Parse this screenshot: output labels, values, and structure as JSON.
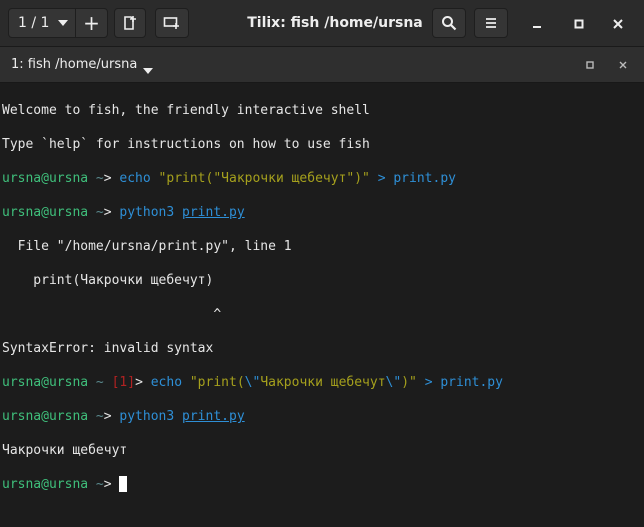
{
  "window": {
    "title": "Tilix: fish /home/ursna"
  },
  "header": {
    "session_label": "1 / 1",
    "add_label": "+"
  },
  "tab": {
    "title": "1: fish /home/ursna"
  },
  "terminal": {
    "welcome": "Welcome to fish, the friendly interactive shell",
    "help": "Type `help` for instructions on how to use fish",
    "prompt_user": "ursna@ursna",
    "prompt_tilde": " ~",
    "prompt_arrow": "> ",
    "cmd1": {
      "name": "echo",
      "arg": "\"print(\"Чакрочки щебечут\")\"",
      "redirect": ">",
      "target": "print.py"
    },
    "cmd2": {
      "name": "python3",
      "arg": "print.py"
    },
    "trace_file": "  File \"/home/ursna/print.py\", line 1",
    "trace_code": "    print(Чакрочки щебечут)",
    "trace_caret": "                           ^",
    "syntax_error": "SyntaxError: invalid syntax",
    "exit_code": "[1]",
    "cmd3": {
      "name": "echo",
      "str_a": "\"print(",
      "esc_a": "\\\"",
      "str_b": "Чакрочки щебечут",
      "esc_b": "\\\"",
      "str_c": ")\"",
      "redirect": ">",
      "target": "print.py"
    },
    "cmd4": {
      "name": "python3",
      "arg": "print.py"
    },
    "output": "Чакрочки щебечут"
  },
  "colors": {
    "prompt_user": "#3fbf7b",
    "command": "#2e8fd6",
    "string": "#a5a01d",
    "error": "#b22222",
    "background": "#1c1c1c"
  },
  "icons": {
    "session_dropdown": "chevron-down-icon",
    "add_terminal_right": "split-right-icon",
    "add_terminal_down": "split-down-icon",
    "search": "search-icon",
    "menu": "hamburger-icon",
    "minimize": "minimize-icon",
    "maximize": "maximize-icon",
    "close": "close-icon",
    "tab_maximize": "tab-maximize-icon",
    "tab_close": "tab-close-icon"
  }
}
